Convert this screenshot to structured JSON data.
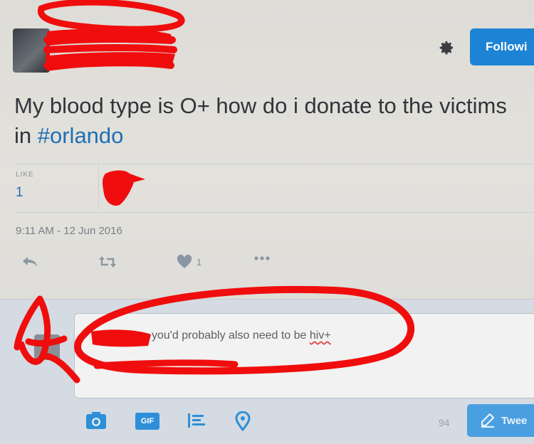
{
  "header": {
    "follow_label": "Followi"
  },
  "tweet": {
    "text_before": "My blood type is O+ how do i donate to the victims in ",
    "hashtag": "#orlando",
    "like_label": "LIKE",
    "like_count": "1",
    "timestamp": "9:11 AM - 12 Jun 2016"
  },
  "actions": {
    "like_count": "1"
  },
  "reply": {
    "text_before": "you'd probably also need to be ",
    "text_underlined": "hiv+"
  },
  "composer": {
    "gif_label": "GIF",
    "char_count": "94",
    "tweet_label": "Twee"
  },
  "colors": {
    "brand_blue": "#1d83d4",
    "hashtag": "#1f6fb3",
    "redaction": "#f00d0d"
  }
}
